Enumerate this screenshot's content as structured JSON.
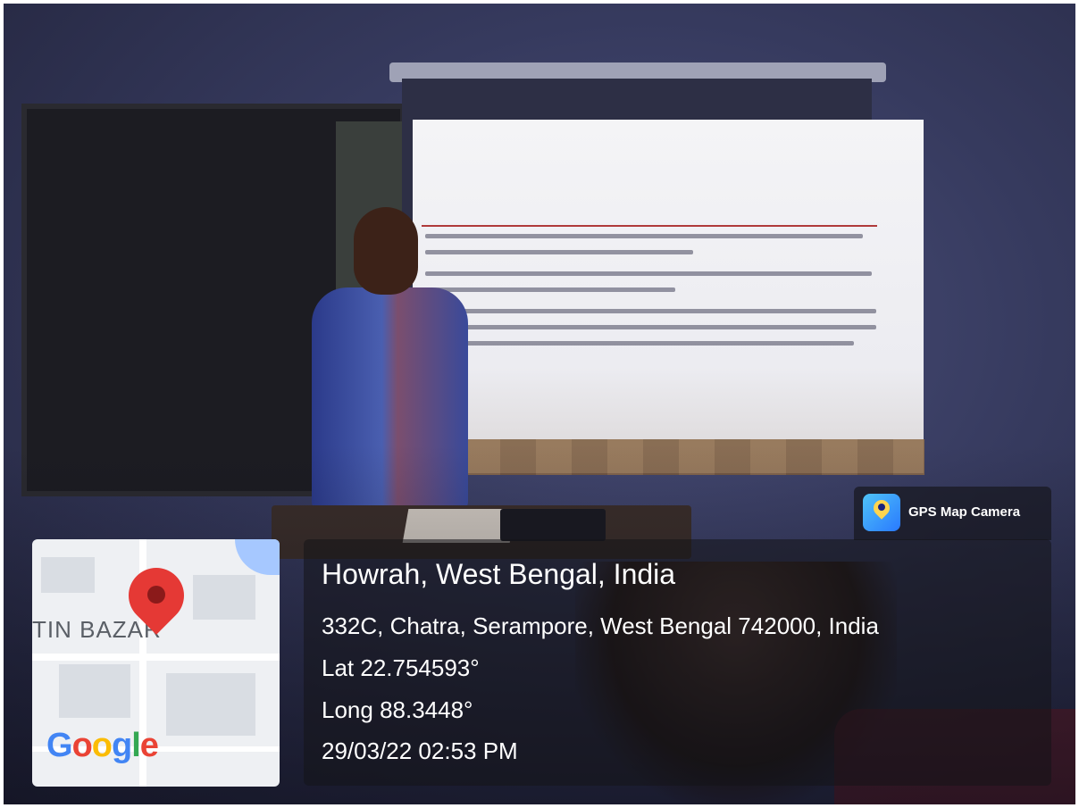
{
  "badge": {
    "app_name": "GPS Map Camera",
    "icon": "gps-map-camera-icon"
  },
  "location": {
    "title": "Howrah, West Bengal, India",
    "address": "332C, Chatra, Serampore, West Bengal 742000, India",
    "latitude": "Lat 22.754593°",
    "longitude": "Long 88.3448°",
    "datetime": "29/03/22 02:53 PM"
  },
  "map": {
    "area_label": "TIN BAZAR",
    "logo": "Google",
    "pin_icon": "map-pin-icon"
  },
  "colors": {
    "pin": "#e53935",
    "overlay": "#141418"
  }
}
